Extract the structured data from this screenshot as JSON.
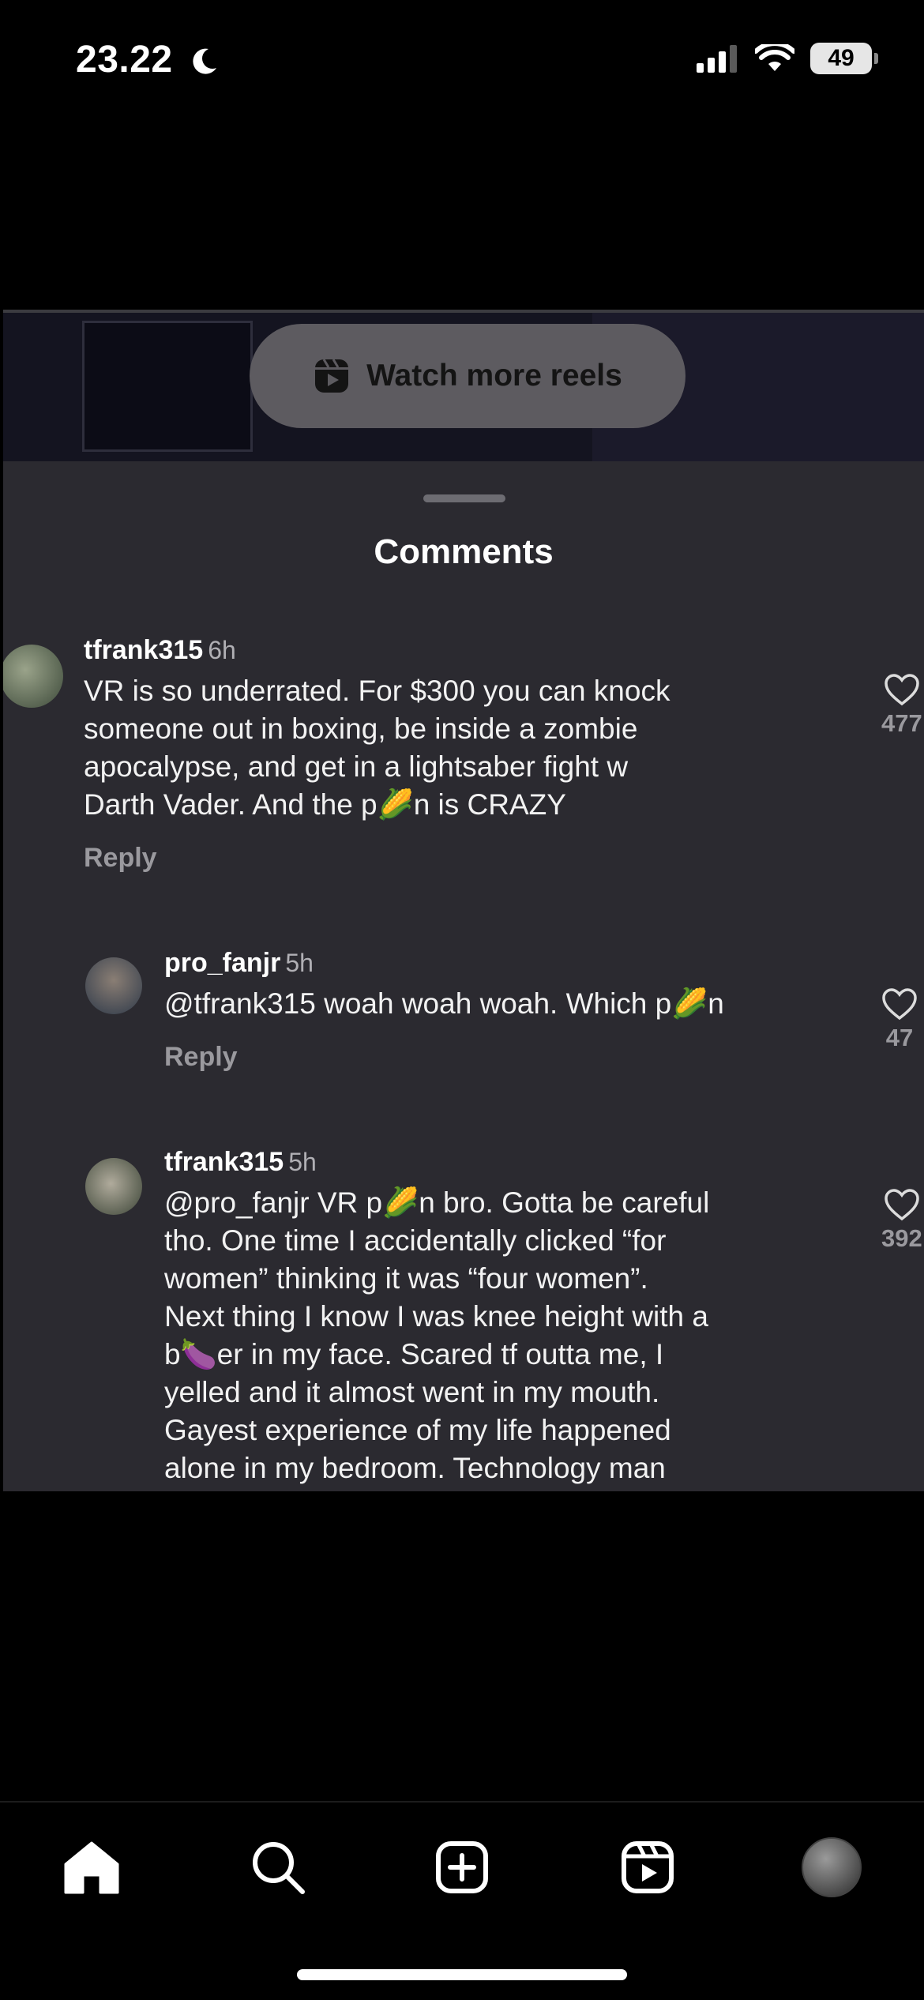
{
  "status_bar": {
    "time": "23.22",
    "battery": "49"
  },
  "video": {
    "watch_more_label": "Watch more reels"
  },
  "comments_sheet": {
    "title": "Comments",
    "comments": [
      {
        "username": "tfrank315",
        "time": "6h",
        "text": "VR is so underrated. For $300 you can knock\nsomeone out in boxing, be inside a zombie\napocalypse, and get in a lightsaber fight w\nDarth Vader. And the p🌽n is CRAZY",
        "reply_label": "Reply",
        "like_count": "477"
      },
      {
        "username": "pro_fanjr",
        "time": "5h",
        "text": "@tfrank315 woah woah woah. Which p🌽n",
        "reply_label": "Reply",
        "like_count": "47"
      },
      {
        "username": "tfrank315",
        "time": "5h",
        "text": "@pro_fanjr VR p🌽n bro. Gotta be careful\ntho. One time I accidentally clicked “for\nwomen” thinking it was “four women”.\nNext thing I know I was knee height with a\nb🍆er in my face. Scared tf outta me, I\nyelled and it almost went in my mouth.\nGayest experience of my life happened\nalone in my bedroom. Technology man",
        "like_count": "392"
      }
    ]
  },
  "nav": {
    "items": [
      "home-icon",
      "search-icon",
      "create-icon",
      "reels-icon",
      "profile-avatar"
    ]
  }
}
